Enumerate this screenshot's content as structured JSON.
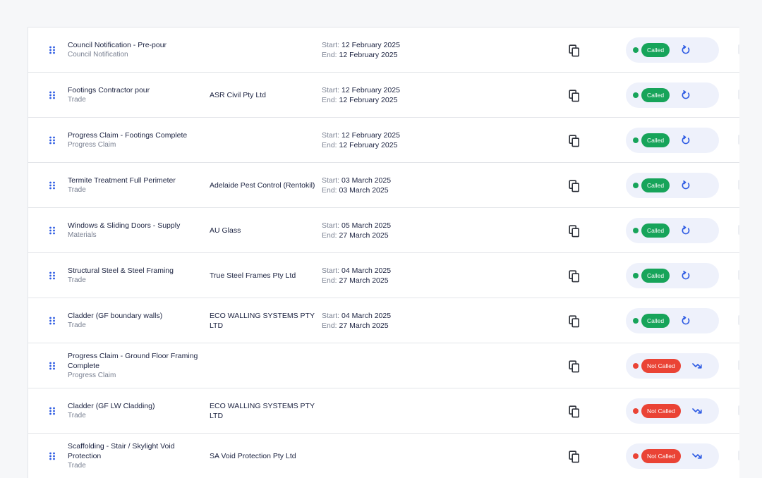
{
  "colors": {
    "called": "#17a45a",
    "not_called": "#ea4335",
    "drag_handle": "#2d5be3",
    "action_icon": "#2d5be3",
    "pill_bg": "#eef1fb"
  },
  "icons": {
    "drag": "drag-handle-icon",
    "copy": "copy-icon",
    "called_action": "refresh-icon",
    "not_called_action": "trend-arrow-icon"
  },
  "labels": {
    "start": "Start:",
    "end": "End:"
  },
  "rows": [
    {
      "name": "Council Notification - Pre-pour",
      "type": "Council Notification",
      "supplier": "",
      "start": "12 February 2025",
      "end": "12 February 2025",
      "status": "Called"
    },
    {
      "name": "Footings Contractor pour",
      "type": "Trade",
      "supplier": "ASR Civil Pty Ltd",
      "start": "12 February 2025",
      "end": "12 February 2025",
      "status": "Called"
    },
    {
      "name": "Progress Claim - Footings Complete",
      "type": "Progress Claim",
      "supplier": "",
      "start": "12 February 2025",
      "end": "12 February 2025",
      "status": "Called"
    },
    {
      "name": "Termite Treatment Full Perimeter",
      "type": "Trade",
      "supplier": "Adelaide Pest Control (Rentokil)",
      "start": "03 March 2025",
      "end": "03 March 2025",
      "status": "Called"
    },
    {
      "name": "Windows & Sliding Doors - Supply",
      "type": "Materials",
      "supplier": "AU Glass",
      "start": "05 March 2025",
      "end": "27 March 2025",
      "status": "Called"
    },
    {
      "name": "Structural Steel & Steel Framing",
      "type": "Trade",
      "supplier": "True Steel Frames Pty Ltd",
      "start": "04 March 2025",
      "end": "27 March 2025",
      "status": "Called"
    },
    {
      "name": "Cladder (GF boundary walls)",
      "type": "Trade",
      "supplier": "ECO WALLING SYSTEMS PTY LTD",
      "start": "04 March 2025",
      "end": "27 March 2025",
      "status": "Called"
    },
    {
      "name": "Progress Claim - Ground Floor Framing Complete",
      "type": "Progress Claim",
      "supplier": "",
      "start": "",
      "end": "",
      "status": "Not Called"
    },
    {
      "name": "Cladder (GF LW Cladding)",
      "type": "Trade",
      "supplier": "ECO WALLING SYSTEMS PTY LTD",
      "start": "",
      "end": "",
      "status": "Not Called"
    },
    {
      "name": "Scaffolding - Stair / Skylight Void Protection",
      "type": "Trade",
      "supplier": "SA Void Protection Pty Ltd",
      "start": "",
      "end": "",
      "status": "Not Called"
    }
  ]
}
